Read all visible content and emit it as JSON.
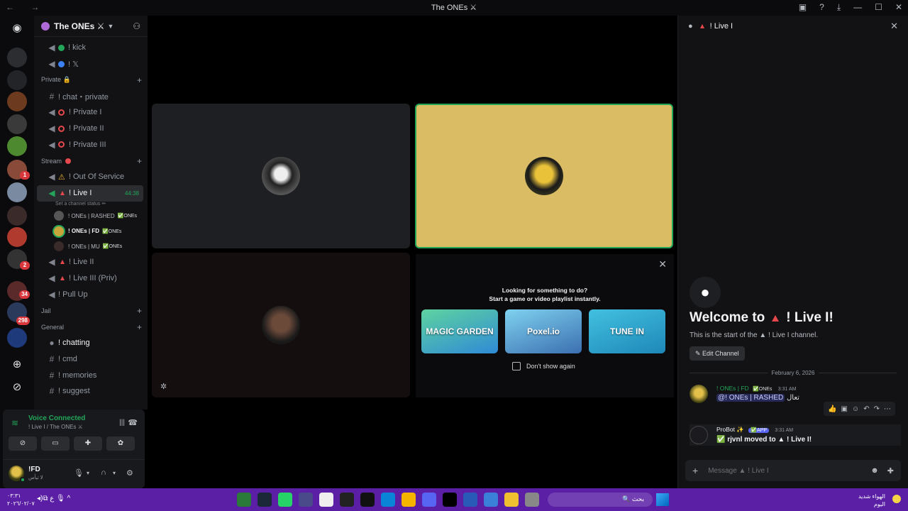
{
  "window": {
    "title": "The ONEs ⚔"
  },
  "server": {
    "name": "The ONEs ⚔"
  },
  "rail": {
    "badges": [
      "1",
      "2",
      "34",
      "298"
    ]
  },
  "channels": {
    "top": [
      {
        "label": "! kick",
        "dot": "#23a55a"
      },
      {
        "label": "! 𝕏",
        "dot": "#3b82f6"
      }
    ],
    "private_category": "Private 🔒",
    "private": [
      {
        "label": "! chat・private",
        "kind": "text"
      },
      {
        "label": "! Private I",
        "kind": "voice"
      },
      {
        "label": "! Private II",
        "kind": "voice"
      },
      {
        "label": "! Private III",
        "kind": "voice"
      }
    ],
    "stream_category": "Stream",
    "stream": [
      {
        "label": "! Out Of Service"
      },
      {
        "label": "! Live I",
        "timer": "44:38",
        "status": "Set a channel status ✏"
      }
    ],
    "voice_users": [
      {
        "name": "! ONEs | RASHED",
        "tag": "✅ONEs"
      },
      {
        "name": "! ONEs | FD",
        "tag": "✅ONEs"
      },
      {
        "name": "! ONEs | MU",
        "tag": "✅ONEs"
      }
    ],
    "stream_more": [
      "! Live II",
      "! Live III (Priv)",
      "! Pull Up"
    ],
    "jail_category": "Jail",
    "general_category": "General",
    "general": [
      "! chatting",
      "! cmd",
      "! memories",
      "! suggest"
    ]
  },
  "voice": {
    "status": "Voice Connected",
    "channel": "! Live I / The ONEs ⚔"
  },
  "user": {
    "name": "!FD",
    "status": "لا تيأس"
  },
  "activity": {
    "line1": "Looking for something to do?",
    "line2": "Start a game or video playlist instantly.",
    "cards": [
      "MAGIC GARDEN",
      "Poxel.io",
      "TUNE IN"
    ],
    "dont_show": "Don't show again"
  },
  "chat": {
    "header": "! Live I",
    "welcome_prefix": "Welcome to",
    "welcome_channel": "! Live I!",
    "start_text": "This is the start of the ▲ ! Live I channel.",
    "edit_button": "Edit Channel",
    "date": "February 6, 2026",
    "messages": [
      {
        "author": "! ONEs | FD",
        "tag": "✅ONEs",
        "time": "3:31 AM",
        "text": "تعال",
        "mention": "@! ONEs | RASHED"
      },
      {
        "author": "ProBot ✨",
        "badge": "✅APP",
        "time": "3:31 AM",
        "text": "✅ rjvnl moved to ▲ ! Live I!"
      }
    ],
    "placeholder": "Message ▲ ! Live I"
  },
  "taskbar": {
    "time": "٠٣:٣١",
    "date": "٢٠٢٦/٠٢/٠٧",
    "search": "بحث",
    "weather_line1": "الهواء شديد",
    "weather_line2": "اليوم"
  },
  "colors": {
    "accent": "#23a55a",
    "live": "#e5484d",
    "taskbar": "#5b1fa6"
  }
}
